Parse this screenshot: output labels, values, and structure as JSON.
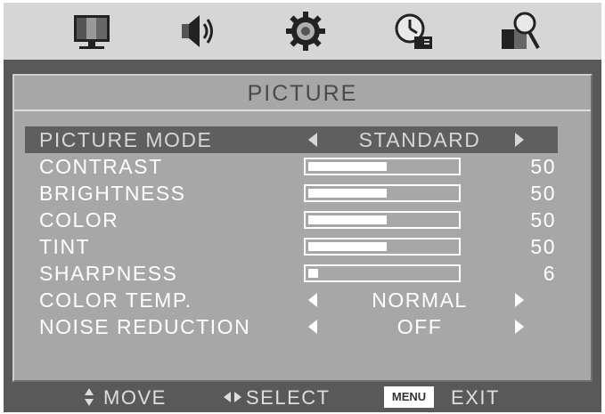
{
  "icon_bar": [
    {
      "name": "picture-icon"
    },
    {
      "name": "sound-icon"
    },
    {
      "name": "setup-gear-icon"
    },
    {
      "name": "timer-clock-icon"
    },
    {
      "name": "lock-search-icon"
    }
  ],
  "panel": {
    "title": "PICTURE"
  },
  "rows": [
    {
      "label": "PICTURE MODE",
      "type": "option",
      "value": "STANDARD",
      "selected": true
    },
    {
      "label": "CONTRAST",
      "type": "slider",
      "value": "50",
      "level": 50
    },
    {
      "label": "BRIGHTNESS",
      "type": "slider",
      "value": "50",
      "level": 50
    },
    {
      "label": "COLOR",
      "type": "slider",
      "value": "50",
      "level": 50
    },
    {
      "label": "TINT",
      "type": "slider",
      "value": "50",
      "level": 50
    },
    {
      "label": "SHARPNESS",
      "type": "slider",
      "value": "6",
      "level": 6
    },
    {
      "label": "COLOR TEMP.",
      "type": "option",
      "value": "NORMAL"
    },
    {
      "label": "NOISE REDUCTION",
      "type": "option",
      "value": "OFF"
    }
  ],
  "footer": {
    "move_label": "MOVE",
    "select_label": "SELECT",
    "menu_key": "MENU",
    "exit_label": "EXIT"
  },
  "colors": {
    "frame": "#595959",
    "panel": "#a7a7a7",
    "icon_bar": "#d6d6d6",
    "selected_row": "#5f5f5f"
  }
}
